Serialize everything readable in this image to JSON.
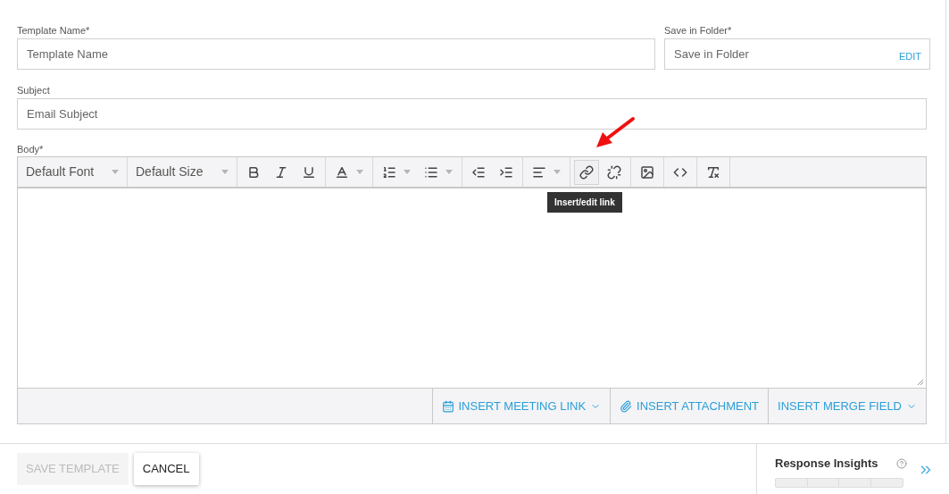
{
  "fields": [
    {
      "label": "Template Name*",
      "placeholder": "Template Name"
    },
    {
      "label": "Save in Folder*",
      "placeholder": "Save in Folder",
      "action": "EDIT"
    },
    {
      "label": "Subject",
      "placeholder": "Email Subject"
    }
  ],
  "body": {
    "label": "Body*",
    "toolbar": {
      "selects": [
        "Default Font",
        "Default Size"
      ],
      "groups": [
        [
          {
            "selected": false,
            "has_menu": false
          },
          {
            "selected": false,
            "has_menu": false
          },
          {
            "selected": false,
            "has_menu": false
          }
        ],
        [
          {
            "selected": false,
            "has_menu": true
          }
        ],
        [
          {
            "selected": false,
            "has_menu": true
          },
          {
            "selected": false,
            "has_menu": true
          }
        ],
        [
          {
            "selected": false,
            "has_menu": false
          },
          {
            "selected": false,
            "has_menu": false
          }
        ],
        [
          {
            "selected": false,
            "has_menu": true
          }
        ],
        [
          {
            "selected": true,
            "has_menu": false
          },
          {
            "selected": false,
            "has_menu": false
          }
        ],
        [
          {
            "selected": false,
            "has_menu": false
          }
        ],
        [
          {
            "selected": false,
            "has_menu": false
          }
        ],
        [
          {
            "selected": false,
            "has_menu": false
          }
        ]
      ]
    },
    "tooltip": "Insert/edit link",
    "actions": [
      {
        "label": "INSERT MEETING LINK",
        "has_menu": true
      },
      {
        "label": "INSERT ATTACHMENT",
        "has_menu": false
      },
      {
        "label": "INSERT MERGE FIELD",
        "has_menu": true
      }
    ]
  },
  "footer": {
    "buttons": [
      {
        "label": "SAVE TEMPLATE",
        "disabled": true
      },
      {
        "label": "CANCEL",
        "disabled": false
      }
    ],
    "insights": {
      "title": "Response Insights"
    }
  }
}
